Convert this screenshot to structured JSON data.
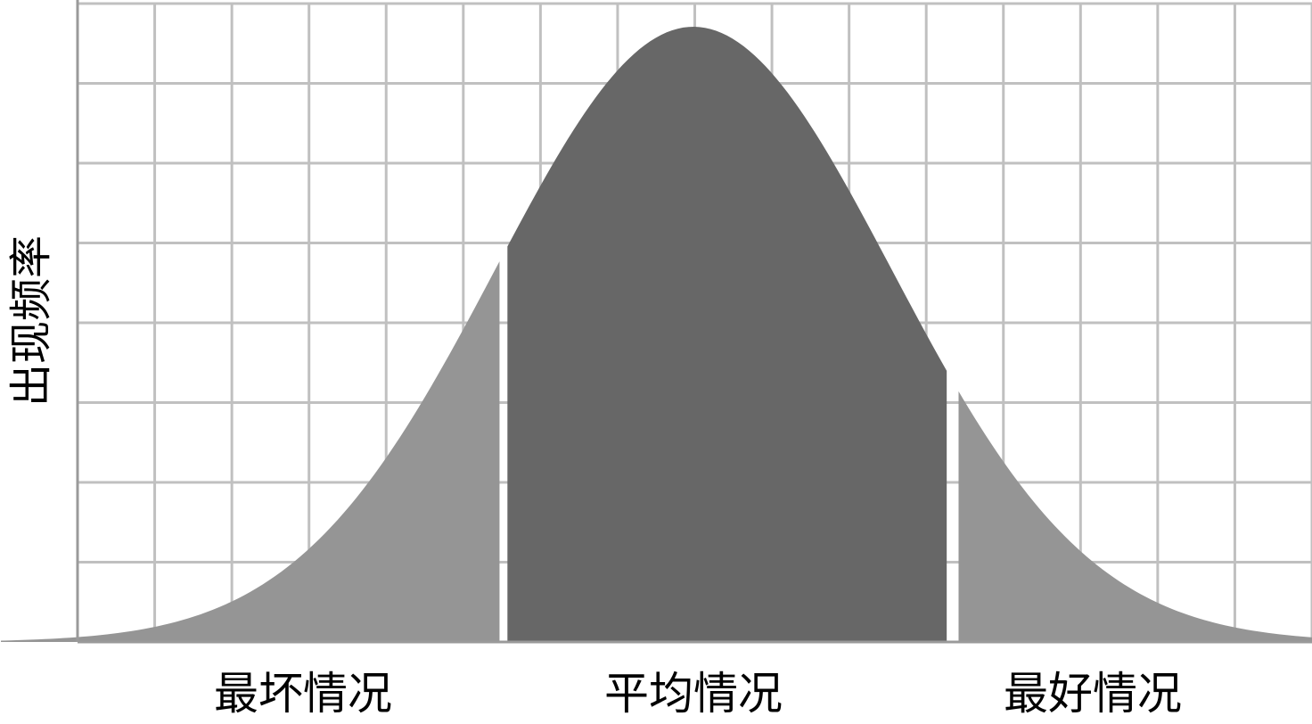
{
  "chart_data": {
    "type": "area",
    "title": "",
    "xlabel": "",
    "ylabel": "出现频率",
    "distribution": "normal",
    "x_range": [
      -3.5,
      3.5
    ],
    "y_range": [
      0,
      1
    ],
    "grid": true,
    "regions": [
      {
        "label": "最坏情况",
        "from": -3.5,
        "to": -0.98,
        "color": "#959595"
      },
      {
        "label": "平均情况",
        "from": -0.94,
        "to": 1.28,
        "color": "#676767"
      },
      {
        "label": "最好情况",
        "from": 1.34,
        "to": 3.5,
        "color": "#959595"
      }
    ],
    "colors": {
      "grid": "#c0c0c0",
      "axis": "#9a9a9a",
      "background": "#ffffff"
    }
  }
}
